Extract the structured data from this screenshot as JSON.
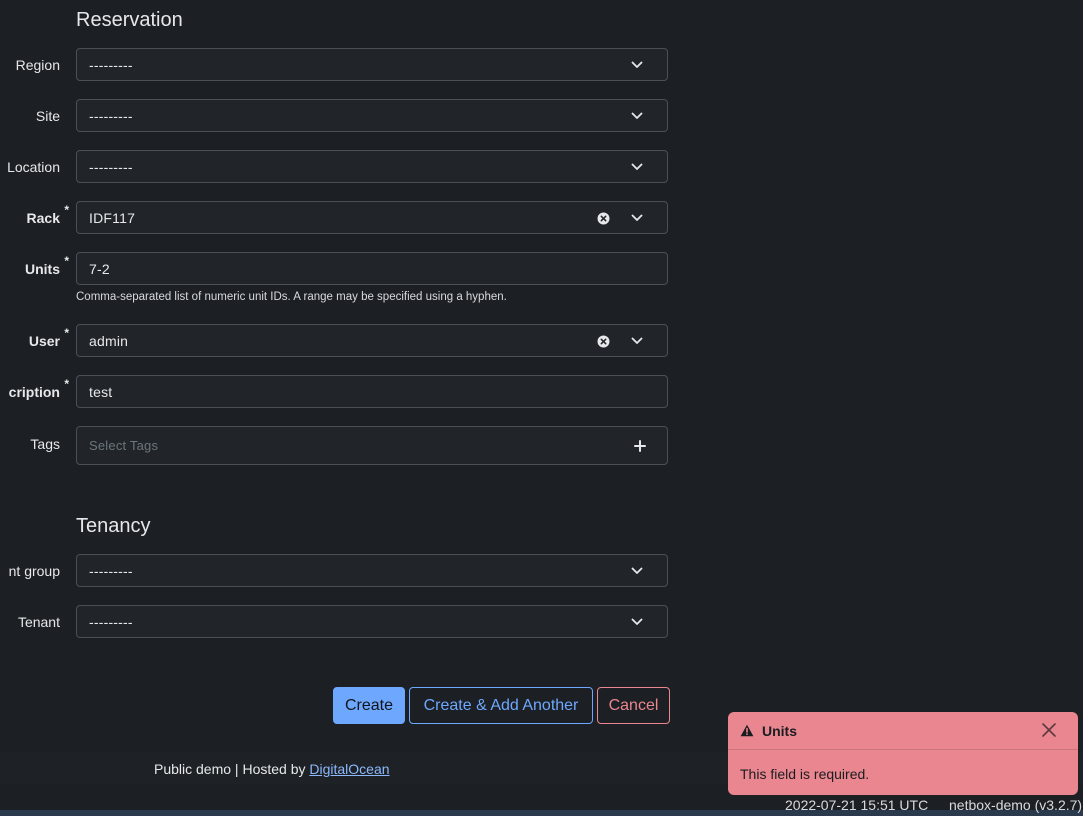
{
  "sections": {
    "reservation_title": "Reservation",
    "tenancy_title": "Tenancy"
  },
  "fields": {
    "region": {
      "label": "Region",
      "value": "---------"
    },
    "site": {
      "label": "Site",
      "value": "---------"
    },
    "location": {
      "label": "Location",
      "value": "---------"
    },
    "rack": {
      "label": "Rack",
      "required_mark": "*",
      "value": "IDF117"
    },
    "units": {
      "label": "Units",
      "required_mark": "*",
      "value": "7-2",
      "help": "Comma-separated list of numeric unit IDs. A range may be specified using a hyphen."
    },
    "user": {
      "label": "User",
      "required_mark": "*",
      "value": "admin"
    },
    "description": {
      "label": "cription",
      "required_mark": "*",
      "value": "test"
    },
    "tags": {
      "label": "Tags",
      "placeholder": "Select Tags"
    },
    "tenant_group": {
      "label": "nt group",
      "value": "---------"
    },
    "tenant": {
      "label": "Tenant",
      "value": "---------"
    }
  },
  "buttons": {
    "create": "Create",
    "create_another": "Create & Add Another",
    "cancel": "Cancel"
  },
  "footer": {
    "prefix": "Public demo | Hosted by ",
    "link": "DigitalOcean",
    "timestamp": "2022-07-21 15:51 UTC",
    "version": "netbox-demo (v3.2.7)"
  },
  "toast": {
    "title": "Units",
    "message": "This field is required."
  },
  "icons": {
    "dropdown": "chevron-down-icon",
    "clear": "clear-icon",
    "add": "plus-icon",
    "warning": "warning-icon",
    "close": "close-icon"
  },
  "colors": {
    "background": "#1c1f23",
    "field_bg": "#212529",
    "primary": "#6ea8fe",
    "danger": "#ea868f"
  }
}
